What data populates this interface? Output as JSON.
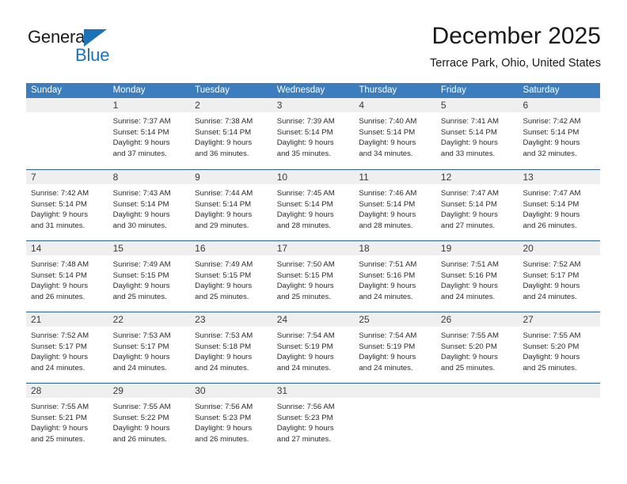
{
  "brand": {
    "name_top": "General",
    "name_bottom": "Blue",
    "accent_color": "#1b72b8"
  },
  "header": {
    "title": "December 2025",
    "subtitle": "Terrace Park, Ohio, United States"
  },
  "calendar": {
    "header_bg": "#3b7dbd",
    "row_divider_color": "#2a6099",
    "daynum_band_bg": "#efefef",
    "weekdays": [
      "Sunday",
      "Monday",
      "Tuesday",
      "Wednesday",
      "Thursday",
      "Friday",
      "Saturday"
    ],
    "weeks": [
      [
        {
          "day": "",
          "lines": []
        },
        {
          "day": "1",
          "lines": [
            "Sunrise: 7:37 AM",
            "Sunset: 5:14 PM",
            "Daylight: 9 hours",
            "and 37 minutes."
          ]
        },
        {
          "day": "2",
          "lines": [
            "Sunrise: 7:38 AM",
            "Sunset: 5:14 PM",
            "Daylight: 9 hours",
            "and 36 minutes."
          ]
        },
        {
          "day": "3",
          "lines": [
            "Sunrise: 7:39 AM",
            "Sunset: 5:14 PM",
            "Daylight: 9 hours",
            "and 35 minutes."
          ]
        },
        {
          "day": "4",
          "lines": [
            "Sunrise: 7:40 AM",
            "Sunset: 5:14 PM",
            "Daylight: 9 hours",
            "and 34 minutes."
          ]
        },
        {
          "day": "5",
          "lines": [
            "Sunrise: 7:41 AM",
            "Sunset: 5:14 PM",
            "Daylight: 9 hours",
            "and 33 minutes."
          ]
        },
        {
          "day": "6",
          "lines": [
            "Sunrise: 7:42 AM",
            "Sunset: 5:14 PM",
            "Daylight: 9 hours",
            "and 32 minutes."
          ]
        }
      ],
      [
        {
          "day": "7",
          "lines": [
            "Sunrise: 7:42 AM",
            "Sunset: 5:14 PM",
            "Daylight: 9 hours",
            "and 31 minutes."
          ]
        },
        {
          "day": "8",
          "lines": [
            "Sunrise: 7:43 AM",
            "Sunset: 5:14 PM",
            "Daylight: 9 hours",
            "and 30 minutes."
          ]
        },
        {
          "day": "9",
          "lines": [
            "Sunrise: 7:44 AM",
            "Sunset: 5:14 PM",
            "Daylight: 9 hours",
            "and 29 minutes."
          ]
        },
        {
          "day": "10",
          "lines": [
            "Sunrise: 7:45 AM",
            "Sunset: 5:14 PM",
            "Daylight: 9 hours",
            "and 28 minutes."
          ]
        },
        {
          "day": "11",
          "lines": [
            "Sunrise: 7:46 AM",
            "Sunset: 5:14 PM",
            "Daylight: 9 hours",
            "and 28 minutes."
          ]
        },
        {
          "day": "12",
          "lines": [
            "Sunrise: 7:47 AM",
            "Sunset: 5:14 PM",
            "Daylight: 9 hours",
            "and 27 minutes."
          ]
        },
        {
          "day": "13",
          "lines": [
            "Sunrise: 7:47 AM",
            "Sunset: 5:14 PM",
            "Daylight: 9 hours",
            "and 26 minutes."
          ]
        }
      ],
      [
        {
          "day": "14",
          "lines": [
            "Sunrise: 7:48 AM",
            "Sunset: 5:14 PM",
            "Daylight: 9 hours",
            "and 26 minutes."
          ]
        },
        {
          "day": "15",
          "lines": [
            "Sunrise: 7:49 AM",
            "Sunset: 5:15 PM",
            "Daylight: 9 hours",
            "and 25 minutes."
          ]
        },
        {
          "day": "16",
          "lines": [
            "Sunrise: 7:49 AM",
            "Sunset: 5:15 PM",
            "Daylight: 9 hours",
            "and 25 minutes."
          ]
        },
        {
          "day": "17",
          "lines": [
            "Sunrise: 7:50 AM",
            "Sunset: 5:15 PM",
            "Daylight: 9 hours",
            "and 25 minutes."
          ]
        },
        {
          "day": "18",
          "lines": [
            "Sunrise: 7:51 AM",
            "Sunset: 5:16 PM",
            "Daylight: 9 hours",
            "and 24 minutes."
          ]
        },
        {
          "day": "19",
          "lines": [
            "Sunrise: 7:51 AM",
            "Sunset: 5:16 PM",
            "Daylight: 9 hours",
            "and 24 minutes."
          ]
        },
        {
          "day": "20",
          "lines": [
            "Sunrise: 7:52 AM",
            "Sunset: 5:17 PM",
            "Daylight: 9 hours",
            "and 24 minutes."
          ]
        }
      ],
      [
        {
          "day": "21",
          "lines": [
            "Sunrise: 7:52 AM",
            "Sunset: 5:17 PM",
            "Daylight: 9 hours",
            "and 24 minutes."
          ]
        },
        {
          "day": "22",
          "lines": [
            "Sunrise: 7:53 AM",
            "Sunset: 5:17 PM",
            "Daylight: 9 hours",
            "and 24 minutes."
          ]
        },
        {
          "day": "23",
          "lines": [
            "Sunrise: 7:53 AM",
            "Sunset: 5:18 PM",
            "Daylight: 9 hours",
            "and 24 minutes."
          ]
        },
        {
          "day": "24",
          "lines": [
            "Sunrise: 7:54 AM",
            "Sunset: 5:19 PM",
            "Daylight: 9 hours",
            "and 24 minutes."
          ]
        },
        {
          "day": "25",
          "lines": [
            "Sunrise: 7:54 AM",
            "Sunset: 5:19 PM",
            "Daylight: 9 hours",
            "and 24 minutes."
          ]
        },
        {
          "day": "26",
          "lines": [
            "Sunrise: 7:55 AM",
            "Sunset: 5:20 PM",
            "Daylight: 9 hours",
            "and 25 minutes."
          ]
        },
        {
          "day": "27",
          "lines": [
            "Sunrise: 7:55 AM",
            "Sunset: 5:20 PM",
            "Daylight: 9 hours",
            "and 25 minutes."
          ]
        }
      ],
      [
        {
          "day": "28",
          "lines": [
            "Sunrise: 7:55 AM",
            "Sunset: 5:21 PM",
            "Daylight: 9 hours",
            "and 25 minutes."
          ]
        },
        {
          "day": "29",
          "lines": [
            "Sunrise: 7:55 AM",
            "Sunset: 5:22 PM",
            "Daylight: 9 hours",
            "and 26 minutes."
          ]
        },
        {
          "day": "30",
          "lines": [
            "Sunrise: 7:56 AM",
            "Sunset: 5:23 PM",
            "Daylight: 9 hours",
            "and 26 minutes."
          ]
        },
        {
          "day": "31",
          "lines": [
            "Sunrise: 7:56 AM",
            "Sunset: 5:23 PM",
            "Daylight: 9 hours",
            "and 27 minutes."
          ]
        },
        {
          "day": "",
          "lines": []
        },
        {
          "day": "",
          "lines": []
        },
        {
          "day": "",
          "lines": []
        }
      ]
    ]
  }
}
